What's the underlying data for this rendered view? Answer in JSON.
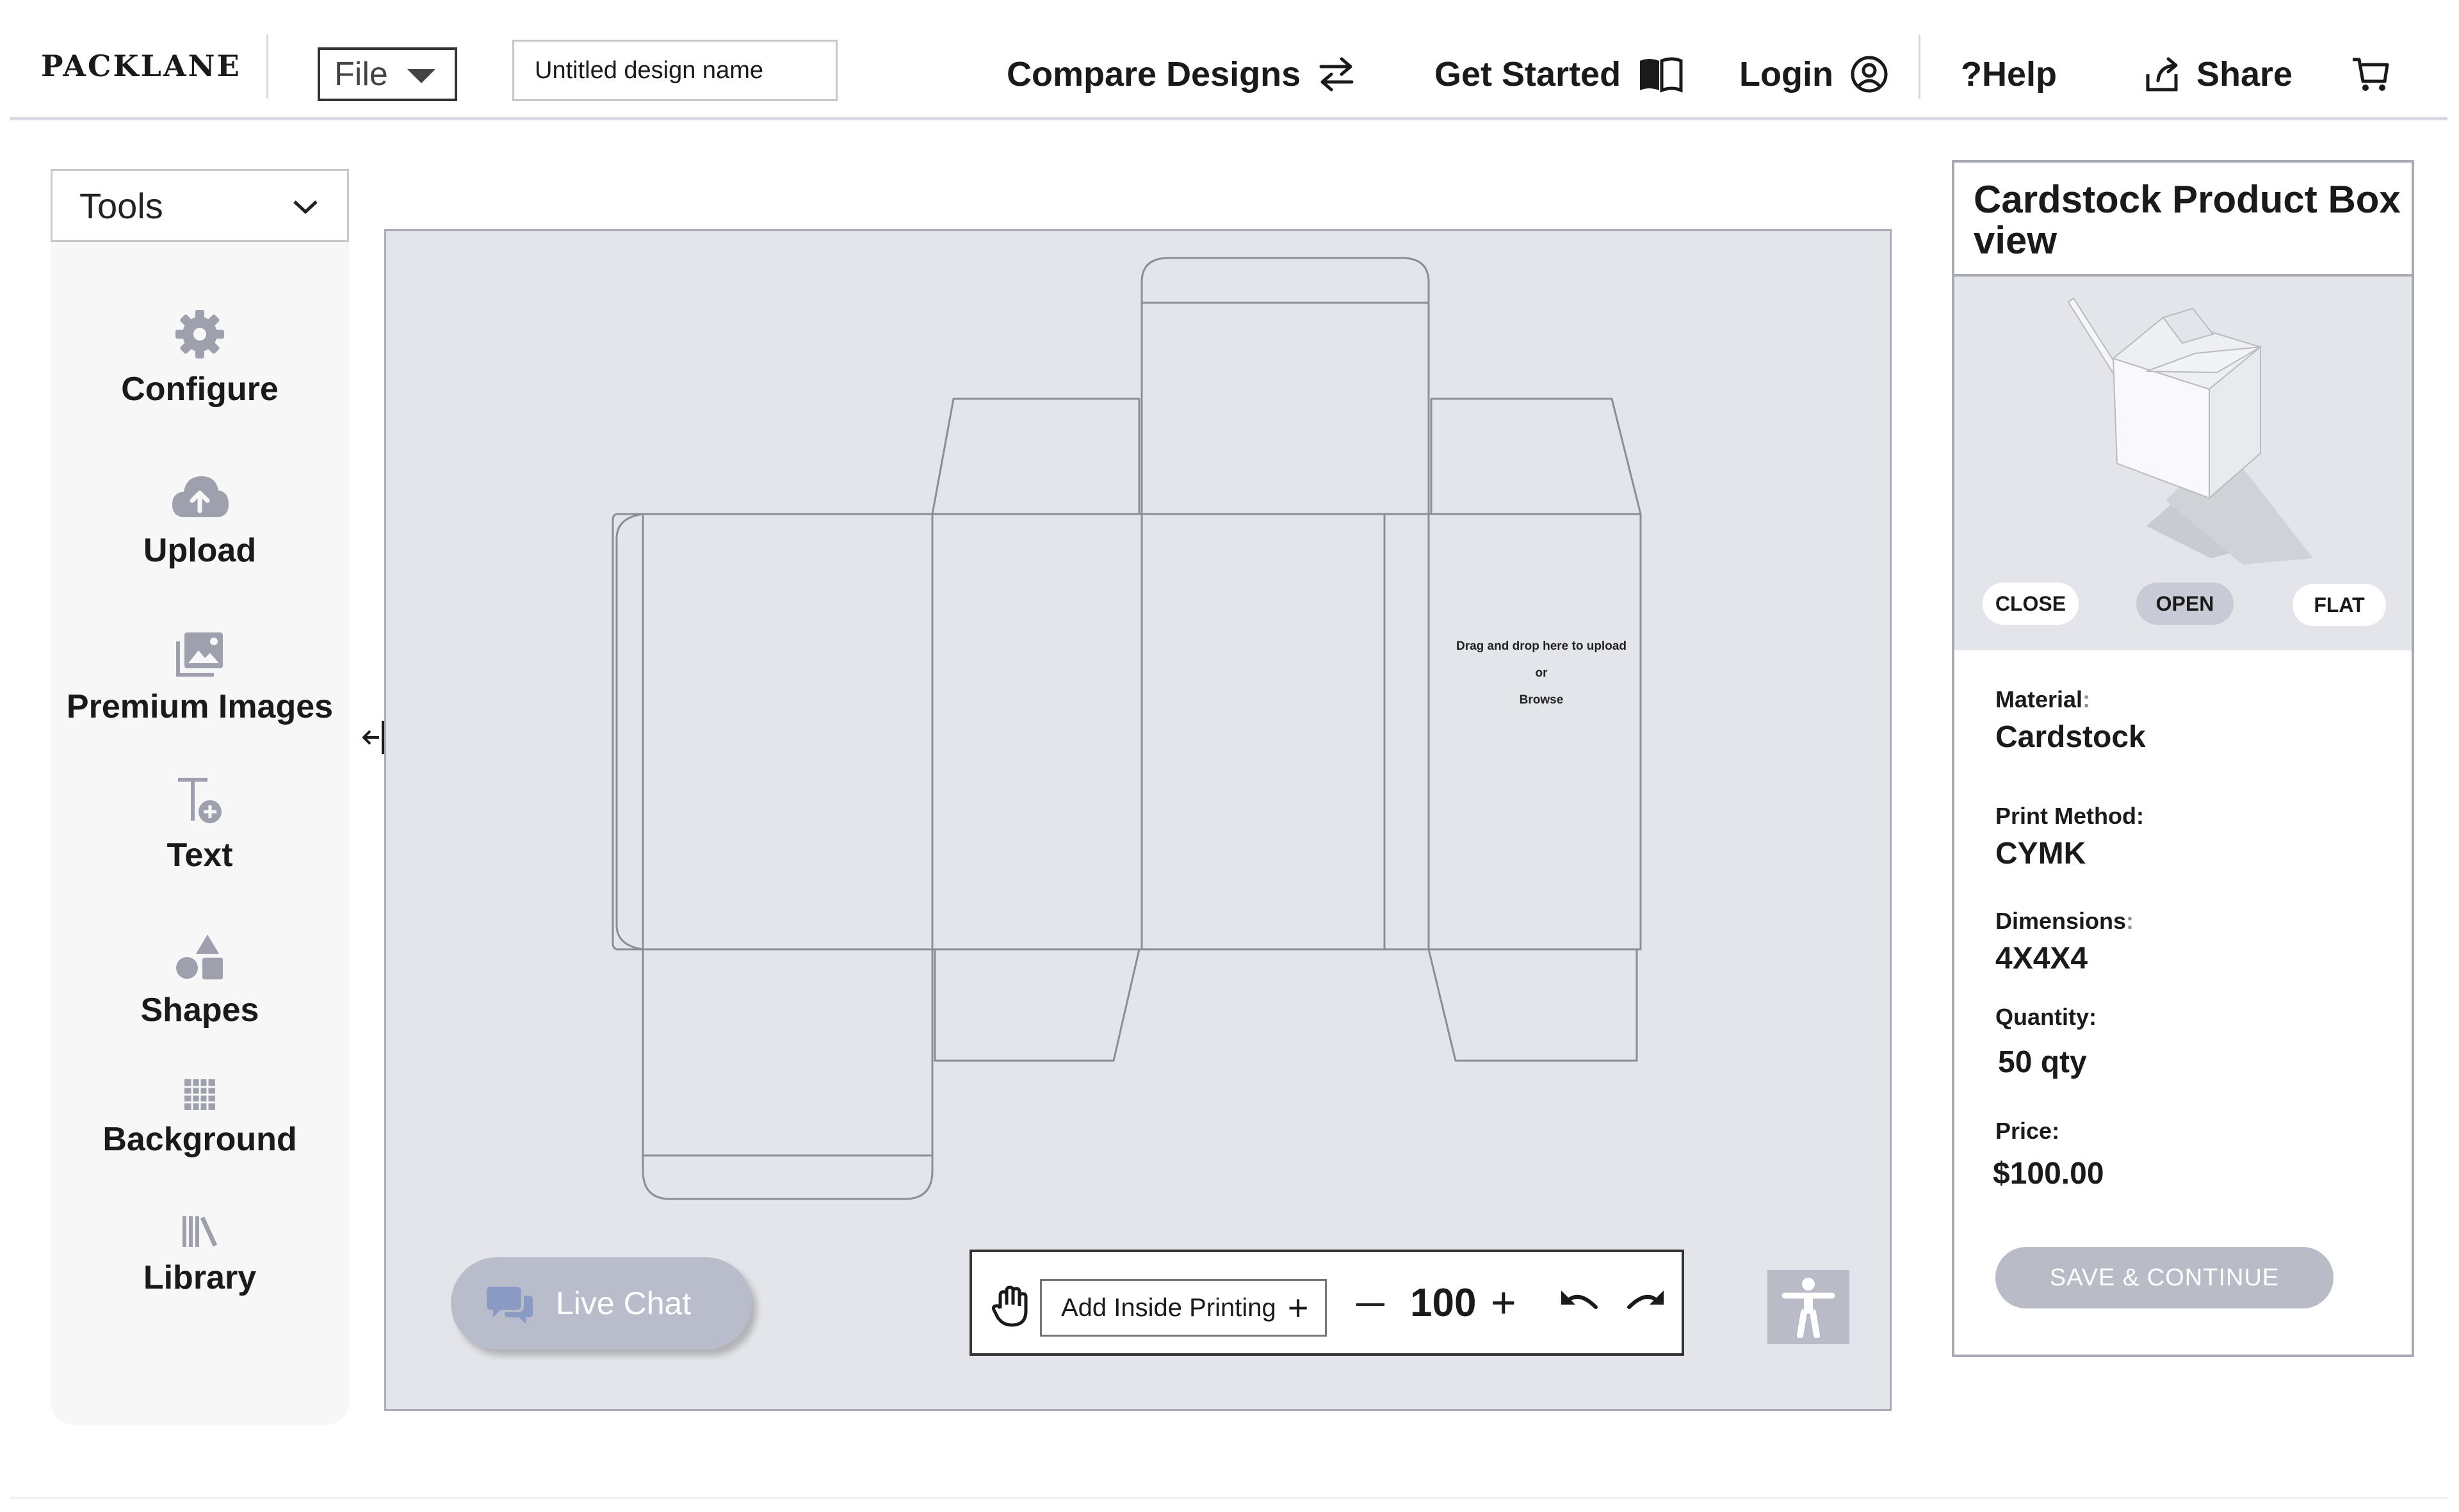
{
  "header": {
    "logo": "PACKLANE",
    "file_menu": "File",
    "design_name_placeholder": "Untitled design name",
    "nav": {
      "compare": "Compare Designs",
      "get_started": "Get Started",
      "login": "Login",
      "help": "?Help",
      "share": "Share"
    },
    "icons": [
      "swap-arrows-icon",
      "book-icon",
      "user-circle-icon",
      "share-icon",
      "cart-icon"
    ]
  },
  "tools": {
    "dropdown_label": "Tools",
    "items": [
      {
        "label": "Configure",
        "icon": "gear-icon"
      },
      {
        "label": "Upload",
        "icon": "cloud-upload-icon"
      },
      {
        "label": "Premium Images",
        "icon": "image-icon"
      },
      {
        "label": "Text",
        "icon": "text-add-icon"
      },
      {
        "label": "Shapes",
        "icon": "shapes-icon"
      },
      {
        "label": "Background",
        "icon": "grid-icon"
      },
      {
        "label": "Library",
        "icon": "library-icon"
      }
    ]
  },
  "canvas": {
    "upload_hint_line1": "Drag and drop here to upload",
    "upload_hint_line2": "or",
    "upload_hint_line3": "Browse"
  },
  "live_chat": "Live Chat",
  "toolbar": {
    "add_inside_printing": "Add Inside Printing",
    "add_plus": "+",
    "zoom": "100",
    "zoom_plus": "+"
  },
  "product": {
    "title": "Cardstock Product Box view",
    "view_buttons": {
      "close": "CLOSE",
      "open": "OPEN",
      "flat": "FLAT"
    },
    "active_view": "OPEN",
    "fields": [
      {
        "label": "Material",
        "value": "Cardstock"
      },
      {
        "label": "Print Method",
        "value": "CYMK"
      },
      {
        "label": "Dimensions",
        "value": "4X4X4"
      },
      {
        "label": "Quantity",
        "value": "50 qty"
      },
      {
        "label": "Price",
        "value": "$100.00"
      }
    ],
    "save_button": "SAVE & CONTINUE"
  },
  "colors": {
    "canvas_bg": "#e4e5ea",
    "muted_button": "#b9bcc7",
    "active_view_button": "#c8cad6",
    "icon_gray": "#9ea1ad",
    "text": "#1a1a1a"
  }
}
